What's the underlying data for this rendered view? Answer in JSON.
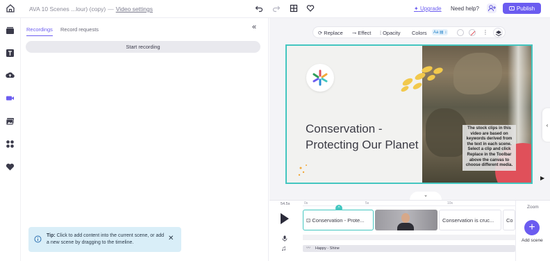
{
  "topbar": {
    "title": "AVA 10 Scenes ...lour) (copy)",
    "separator": "—",
    "video_settings": "Video settings",
    "upgrade": "Upgrade",
    "help": "Need help?",
    "publish": "Publish"
  },
  "panel": {
    "tabs": [
      "Recordings",
      "Record requests"
    ],
    "start_recording": "Start recording",
    "tip_label": "Tip:",
    "tip_text": "Click to add content into the current scene, or add a new scene by dragging to the timeline."
  },
  "toolbar": {
    "replace": "Replace",
    "effect": "Effect",
    "opacity": "Opacity",
    "colors": "Colors",
    "aa": "Aa"
  },
  "canvas": {
    "headline": "Conservation - Protecting Our Planet",
    "overlay": "The stock clips in this video are based on keywords derived from the text in each scene. Select a clip and click Replace in the Toolbar above the canvas to choose different media."
  },
  "timeline": {
    "duration": "54.5s",
    "ticks": [
      "0s",
      "5s",
      "10s"
    ],
    "scenes": [
      "Conservation - Prote...",
      "Conservation is cruc...",
      "Co"
    ],
    "scene_marker": "^",
    "audio": "Happy - Shine",
    "zoom": "Zoom",
    "add_scene": "Add scene"
  },
  "colors": {
    "accent": "#6b5cf0",
    "teal": "#43c6c0",
    "tip_bg": "#d9eef8"
  }
}
